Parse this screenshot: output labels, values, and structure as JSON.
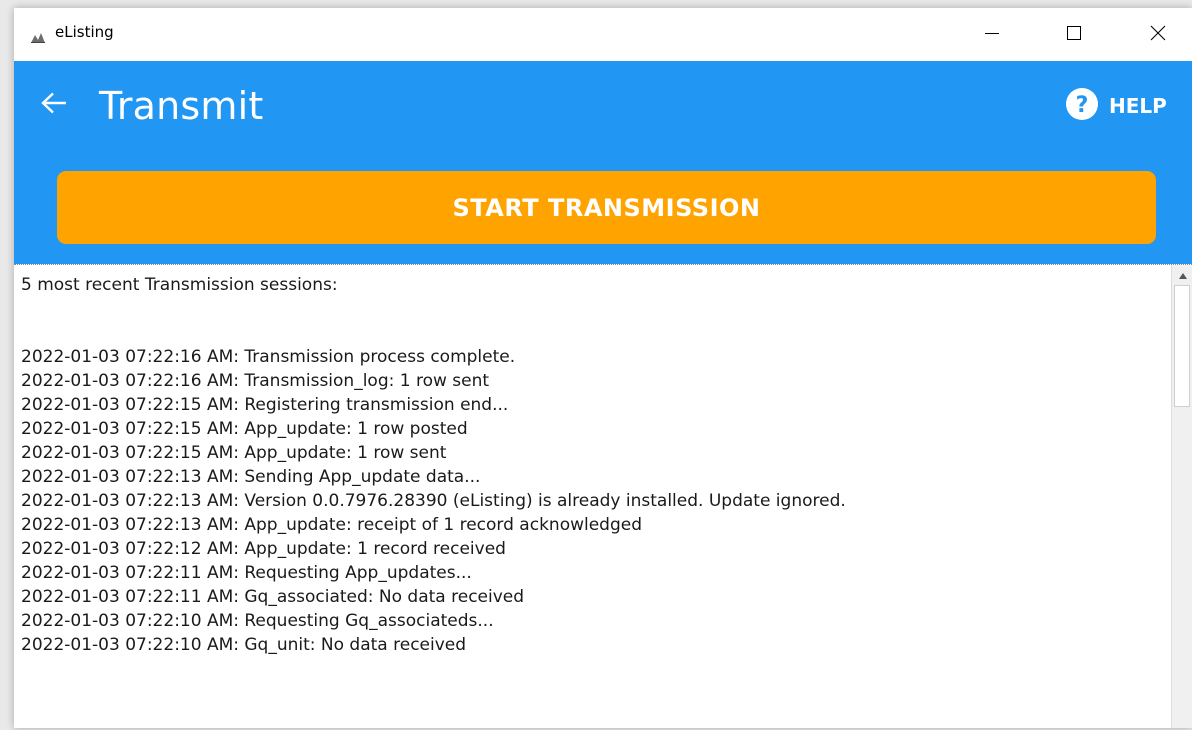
{
  "window": {
    "title": "eListing",
    "controls": {
      "minimize": "minimize",
      "maximize": "maximize",
      "close": "close"
    }
  },
  "header": {
    "title": "Transmit",
    "help_label": "HELP",
    "start_button_label": "START TRANSMISSION",
    "colors": {
      "header_bg": "#2196f3",
      "start_button_bg": "#ffa300",
      "text": "#ffffff"
    }
  },
  "log": {
    "heading": "5 most recent Transmission sessions:",
    "lines": [
      "2022-01-03 07:22:16 AM: Transmission process complete.",
      "2022-01-03 07:22:16 AM: Transmission_log: 1 row sent",
      "2022-01-03 07:22:15 AM: Registering transmission end...",
      "2022-01-03 07:22:15 AM: App_update: 1 row posted",
      "2022-01-03 07:22:15 AM: App_update: 1 row sent",
      "2022-01-03 07:22:13 AM: Sending App_update data...",
      "2022-01-03 07:22:13 AM: Version 0.0.7976.28390 (eListing) is already installed. Update ignored.",
      "2022-01-03 07:22:13 AM: App_update: receipt of 1 record acknowledged",
      "2022-01-03 07:22:12 AM: App_update: 1 record received",
      "2022-01-03 07:22:11 AM: Requesting App_updates...",
      "2022-01-03 07:22:11 AM: Gq_associated: No data received",
      "2022-01-03 07:22:10 AM: Requesting Gq_associateds...",
      "2022-01-03 07:22:10 AM: Gq_unit: No data received"
    ]
  },
  "icons": {
    "app": "app-icon",
    "back": "arrow-left-icon",
    "help": "question-circle-icon",
    "scroll_up": "triangle-up-icon"
  }
}
